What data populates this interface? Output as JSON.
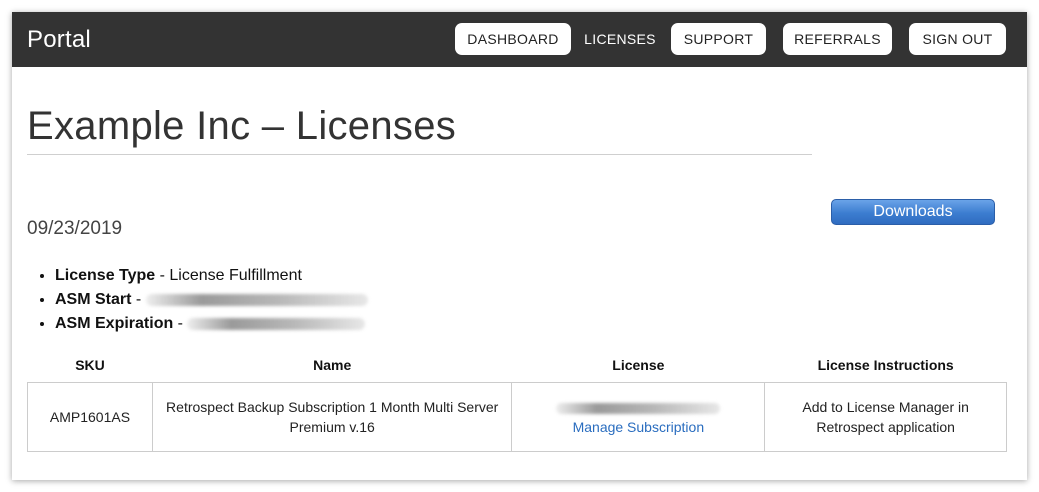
{
  "header": {
    "brand": "Portal",
    "nav": [
      {
        "label": "DASHBOARD",
        "active": false
      },
      {
        "label": "LICENSES",
        "active": true
      },
      {
        "label": "SUPPORT",
        "active": false
      },
      {
        "label": "REFERRALS",
        "active": false
      },
      {
        "label": "SIGN OUT",
        "active": false
      }
    ]
  },
  "main": {
    "title": "Example Inc – Licenses",
    "date": "09/23/2019",
    "downloads_label": "Downloads",
    "details": [
      {
        "label": "License Type",
        "separator": " - ",
        "value": "License Fulfillment",
        "redacted": false
      },
      {
        "label": "ASM Start",
        "separator": " - ",
        "value": "",
        "redacted": true
      },
      {
        "label": "ASM Expiration",
        "separator": " - ",
        "value": "",
        "redacted": true
      }
    ]
  },
  "table": {
    "headers": [
      "SKU",
      "Name",
      "License",
      "License Instructions"
    ],
    "rows": [
      {
        "sku": "AMP1601AS",
        "name": "Retrospect Backup Subscription 1 Month Multi Server Premium v.16",
        "license_key": "",
        "license_link": "Manage Subscription",
        "instructions": "Add to License Manager in Retrospect application"
      }
    ]
  },
  "colors": {
    "topbar": "#333333",
    "link": "#2a6dbf",
    "button_blue": "#3c7dd0"
  }
}
